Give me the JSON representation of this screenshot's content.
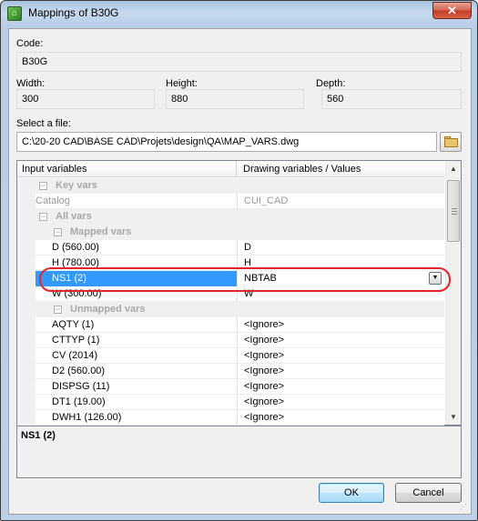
{
  "window": {
    "title": "Mappings of B30G",
    "icon": "app-icon",
    "close_glyph": "✕"
  },
  "code": {
    "label": "Code:",
    "value": "B30G"
  },
  "width": {
    "label": "Width:",
    "value": "300"
  },
  "height": {
    "label": "Height:",
    "value": "880"
  },
  "depth": {
    "label": "Depth:",
    "value": "560"
  },
  "file": {
    "label": "Select a file:",
    "value": "C:\\20-20 CAD\\BASE CAD\\Projets\\design\\QA\\MAP_VARS.dwg",
    "browse_icon": "folder-icon"
  },
  "grid": {
    "col1_header": "Input variables",
    "col2_header": "Drawing variables / Values",
    "rows": [
      {
        "type": "category",
        "level": 0,
        "label": "Key vars",
        "expanded": true
      },
      {
        "type": "item",
        "level": 1,
        "name": "Catalog",
        "value": "CUI_CAD",
        "disabled": true
      },
      {
        "type": "category",
        "level": 0,
        "label": "All vars",
        "expanded": true
      },
      {
        "type": "category",
        "level": 1,
        "label": "Mapped vars",
        "expanded": true
      },
      {
        "type": "item",
        "level": 2,
        "name": "D (560.00)",
        "value": "D"
      },
      {
        "type": "item",
        "level": 2,
        "name": "H (780.00)",
        "value": "H"
      },
      {
        "type": "item",
        "level": 2,
        "name": "NS1 (2)",
        "value": "NBTAB",
        "selected": true,
        "combo": true
      },
      {
        "type": "item",
        "level": 2,
        "name": "W (300.00)",
        "value": "W"
      },
      {
        "type": "category",
        "level": 1,
        "label": "Unmapped vars",
        "expanded": true
      },
      {
        "type": "item",
        "level": 2,
        "name": "AQTY (1)",
        "value": "<Ignore>"
      },
      {
        "type": "item",
        "level": 2,
        "name": "CTTYP (1)",
        "value": "<Ignore>"
      },
      {
        "type": "item",
        "level": 2,
        "name": "CV (2014)",
        "value": "<Ignore>"
      },
      {
        "type": "item",
        "level": 2,
        "name": "D2 (560.00)",
        "value": "<Ignore>"
      },
      {
        "type": "item",
        "level": 2,
        "name": "DISPSG (11)",
        "value": "<Ignore>"
      },
      {
        "type": "item",
        "level": 2,
        "name": "DT1 (19.00)",
        "value": "<Ignore>"
      },
      {
        "type": "item",
        "level": 2,
        "name": "DWH1 (126.00)",
        "value": "<Ignore>"
      }
    ]
  },
  "description": {
    "title": "NS1 (2)"
  },
  "buttons": {
    "ok": "OK",
    "cancel": "Cancel"
  },
  "colors": {
    "selection": "#3399ff",
    "highlight_ring": "#e0262b"
  }
}
